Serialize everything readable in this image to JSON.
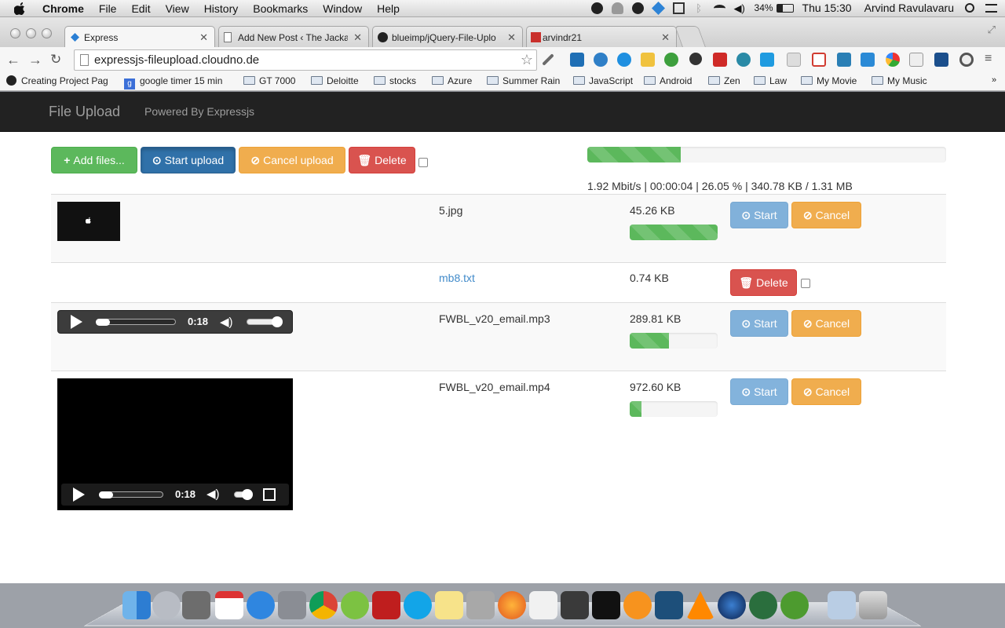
{
  "menubar": {
    "app": "Chrome",
    "items": [
      "File",
      "Edit",
      "View",
      "History",
      "Bookmarks",
      "Window",
      "Help"
    ],
    "battery": "34%",
    "clock": "Thu 15:30",
    "user": "Arvind Ravulavaru"
  },
  "tabs": [
    {
      "title": "Express",
      "active": true
    },
    {
      "title": "Add New Post ‹ The Jackal",
      "active": false
    },
    {
      "title": "blueimp/jQuery-File-Uplo",
      "active": false
    },
    {
      "title": "arvindr21",
      "active": false
    }
  ],
  "address": {
    "url": "expressjs-fileupload.cloudno.de"
  },
  "bookmarks": [
    {
      "label": "Creating Project Pag",
      "type": "page"
    },
    {
      "label": "google timer 15 min",
      "type": "page"
    },
    {
      "label": "GT 7000",
      "type": "folder"
    },
    {
      "label": "Deloitte",
      "type": "folder"
    },
    {
      "label": "stocks",
      "type": "folder"
    },
    {
      "label": "Azure",
      "type": "folder"
    },
    {
      "label": "Summer Rain",
      "type": "folder"
    },
    {
      "label": "JavaScript",
      "type": "folder"
    },
    {
      "label": "Android",
      "type": "folder"
    },
    {
      "label": "Zen",
      "type": "folder"
    },
    {
      "label": "Law",
      "type": "folder"
    },
    {
      "label": "My Movie",
      "type": "folder"
    },
    {
      "label": "My Music",
      "type": "folder"
    }
  ],
  "navbar": {
    "brand": "File Upload",
    "link": "Powered By Expressjs"
  },
  "actions": {
    "add": "Add files...",
    "start": "Start upload",
    "cancel": "Cancel upload",
    "delete": "Delete"
  },
  "global_progress": {
    "fraction": 0.2605,
    "text": "1.92 Mbit/s | 00:00:04 | 26.05 % | 340.78 KB / 1.31 MB"
  },
  "files": [
    {
      "name": "5.jpg",
      "size": "45.26 KB",
      "progress": 1.0,
      "preview": "image",
      "status": "pending",
      "start": "Start",
      "cancel": "Cancel"
    },
    {
      "name": "mb8.txt",
      "size": "0.74 KB",
      "preview": "none",
      "status": "done",
      "delete": "Delete"
    },
    {
      "name": "FWBL_v20_email.mp3",
      "size": "289.81 KB",
      "progress": 0.45,
      "preview": "audio",
      "status": "pending",
      "time": "0:18",
      "start": "Start",
      "cancel": "Cancel"
    },
    {
      "name": "FWBL_v20_email.mp4",
      "size": "972.60 KB",
      "progress": 0.13,
      "preview": "video",
      "status": "pending",
      "time": "0:18",
      "start": "Start",
      "cancel": "Cancel"
    }
  ],
  "colors": {
    "success": "#5cb85c",
    "primary": "#428bca",
    "warning": "#f0ad4e",
    "danger": "#d9534f",
    "navbar": "#222222"
  }
}
